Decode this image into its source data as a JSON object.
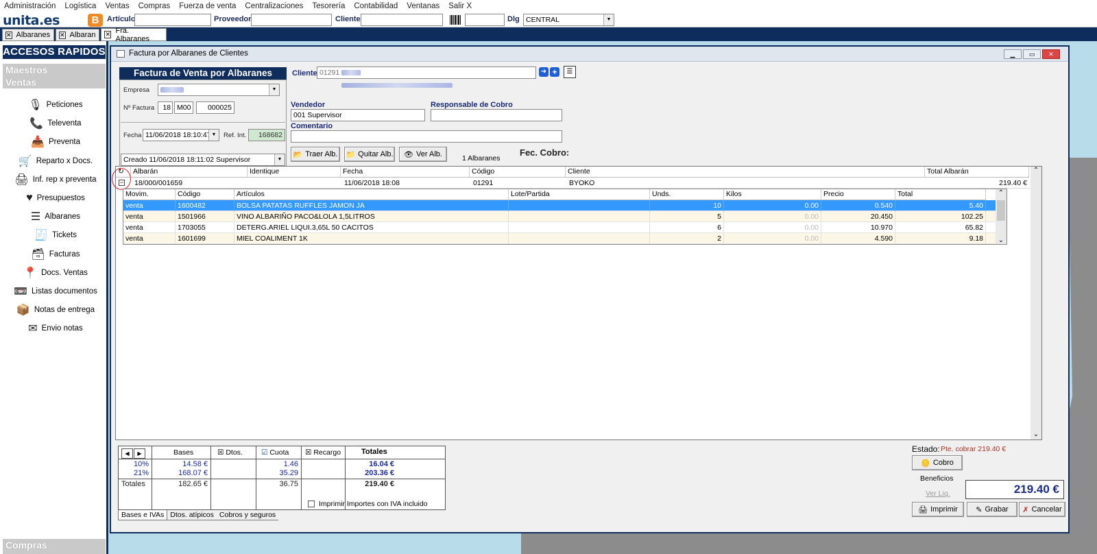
{
  "menu": [
    "Administración",
    "Logística",
    "Ventas",
    "Compras",
    "Fuerza de venta",
    "Centralizaciones",
    "Tesorería",
    "Contabilidad",
    "Ventanas",
    "Salir X"
  ],
  "toolbar": {
    "logo": "unita.es",
    "logo_badge": "B",
    "articulo_label": "Artículo",
    "proveedor_label": "Proveedor",
    "cliente_label": "Cliente",
    "dlg_label": "Dlg",
    "dlg_value": "CENTRAL"
  },
  "tabs": [
    "Albaranes",
    "Albaran",
    "Fra. Albaranes"
  ],
  "sidebar": {
    "title": "ACCESOS RAPIDOS",
    "section1": "Maestros",
    "section2": "Ventas",
    "section3": "Compras",
    "items": [
      "Peticiones",
      "Televenta",
      "Preventa",
      "Reparto x Docs.",
      "Inf. rep x preventa",
      "Presupuestos",
      "Albaranes",
      "Tickets",
      "Facturas",
      "Docs. Ventas",
      "Listas documentos",
      "Notas de entrega",
      "Envio notas"
    ],
    "icons": [
      "microphone-icon",
      "phone-icon",
      "inbox-icon",
      "cart-icon",
      "printer-icon",
      "heart-icon",
      "document-icon",
      "ticket-icon",
      "invoice-icon",
      "pin-icon",
      "voicemail-icon",
      "box-icon",
      "envelope-icon"
    ]
  },
  "window": {
    "title": "Factura por Albaranes de Clientes",
    "heading": "Factura de Venta por Albaranes",
    "empresa_label": "Empresa",
    "nfactura_label": "Nº Factura",
    "nfactura": [
      "18",
      "M00",
      "000025"
    ],
    "fecha_label": "Fecha",
    "fecha": "11/06/2018 18:10:47",
    "refint_label": "Ref. Int.",
    "refint": "168682",
    "creado": "Creado 11/06/2018 18:11:02 Supervisor",
    "cliente_label": "Cliente",
    "cliente_value": "01291",
    "vendedor_label": "Vendedor",
    "vendedor": "001 Supervisor",
    "responsable_label": "Responsable de Cobro",
    "comentario_label": "Comentario",
    "btn_traer": "Traer Alb.",
    "btn_quitar": "Quitar Alb.",
    "btn_ver": "Ver Alb.",
    "albaranes_count": "1 Albaranes",
    "fec_cobro_label": "Fec. Cobro:"
  },
  "grid": {
    "headers": [
      "Albarán",
      "Identique",
      "Fecha",
      "Código",
      "Cliente",
      "Total Albarán"
    ],
    "row": {
      "albaran": "18/000/001659",
      "identique": "",
      "fecha": "11/06/2018 18:08",
      "codigo": "01291",
      "cliente": "BYOKO",
      "total": "219.40 €"
    },
    "sub_headers": [
      "Movim.",
      "Código",
      "Artículos",
      "Lote/Partida",
      "Unds.",
      "Kilos",
      "Precio",
      "Total"
    ],
    "lines": [
      {
        "movim": "venta",
        "codigo": "1600482",
        "articulo": "BOLSA PATATAS RUFFLES JAMON JA",
        "lote": "",
        "unds": "10",
        "kilos": "0.00",
        "precio": "0.540",
        "total": "5.40"
      },
      {
        "movim": "venta",
        "codigo": "1501966",
        "articulo": "VINO ALBARIÑO PACO&LOLA 1,5LITROS",
        "lote": "",
        "unds": "5",
        "kilos": "0.00",
        "precio": "20.450",
        "total": "102.25"
      },
      {
        "movim": "venta",
        "codigo": "1703055",
        "articulo": "DETERG.ARIEL LIQUI.3,65L 50 CACITOS",
        "lote": "",
        "unds": "6",
        "kilos": "0.00",
        "precio": "10.970",
        "total": "65.82"
      },
      {
        "movim": "venta",
        "codigo": "1601699",
        "articulo": "MIEL COALIMENT 1K",
        "lote": "",
        "unds": "2",
        "kilos": "0.00",
        "precio": "4.590",
        "total": "9.18"
      }
    ]
  },
  "totals": {
    "headers": [
      "Bases",
      "Dtos.",
      "Cuota",
      "Recargo",
      "Totales"
    ],
    "rows": [
      {
        "label": "10%",
        "bases": "14.58 €",
        "cuota": "1.46",
        "total": "16.04 €"
      },
      {
        "label": "21%",
        "bases": "168.07 €",
        "cuota": "35.29",
        "total": "203.36 €"
      },
      {
        "label": "Totales",
        "bases": "182.65 €",
        "cuota": "36.75",
        "total": "219.40 €"
      }
    ],
    "imprimir_iva": "Imprimir Importes con IVA incluido",
    "bottom_tabs": [
      "Bases e IVAs",
      "Dtos. atípicos",
      "Cobros y seguros"
    ]
  },
  "right": {
    "estado_label": "Estado:",
    "estado_value": "Pte. cobrar 219.40 €",
    "btn_cobro": "Cobro",
    "beneficios": "Beneficios",
    "ver_liq": "Ver Liq.",
    "total": "219.40 €",
    "btn_imprimir": "Imprimir",
    "btn_grabar": "Grabar",
    "btn_cancelar": "Cancelar"
  },
  "colors": {
    "navy": "#0f2d5c",
    "selection": "#3399ff",
    "estado": "#b03020"
  }
}
